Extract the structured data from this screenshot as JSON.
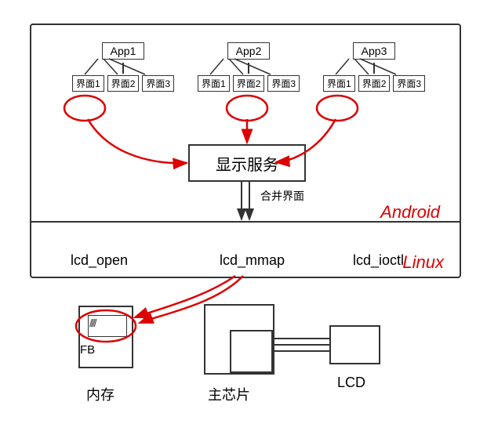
{
  "apps": [
    {
      "name": "App1",
      "ui": [
        "界面1",
        "界面2",
        "界面3"
      ]
    },
    {
      "name": "App2",
      "ui": [
        "界面1",
        "界面2",
        "界面3"
      ]
    },
    {
      "name": "App3",
      "ui": [
        "界面1",
        "界面2",
        "界面3"
      ]
    }
  ],
  "display_service": "显示服务",
  "merge_label": "合并界面",
  "syscalls": {
    "open": "lcd_open",
    "mmap": "lcd_mmap",
    "ioctl": "lcd_ioctl"
  },
  "os_labels": {
    "android": "Android",
    "linux": "Linux"
  },
  "hw": {
    "fb": "FB",
    "mem": "内存",
    "chip": "主芯片",
    "lcd": "LCD"
  },
  "chart_data": {
    "type": "diagram",
    "title": "Android display stack to Linux framebuffer/LCD",
    "nodes": [
      {
        "id": "app1",
        "label": "App1",
        "children": [
          "界面1",
          "界面2",
          "界面3"
        ]
      },
      {
        "id": "app2",
        "label": "App2",
        "children": [
          "界面1",
          "界面2",
          "界面3"
        ]
      },
      {
        "id": "app3",
        "label": "App3",
        "children": [
          "界面1",
          "界面2",
          "界面3"
        ]
      },
      {
        "id": "display_service",
        "label": "显示服务"
      },
      {
        "id": "merge",
        "label": "合并界面"
      },
      {
        "id": "lcd_open",
        "label": "lcd_open"
      },
      {
        "id": "lcd_mmap",
        "label": "lcd_mmap"
      },
      {
        "id": "lcd_ioctl",
        "label": "lcd_ioctl"
      },
      {
        "id": "fb",
        "label": "FB"
      },
      {
        "id": "mem",
        "label": "内存"
      },
      {
        "id": "chip",
        "label": "主芯片"
      },
      {
        "id": "lcd_hw",
        "label": "LCD"
      }
    ],
    "edges": [
      {
        "from": "app1/界面1",
        "to": "display_service",
        "highlight": true
      },
      {
        "from": "app2/界面2",
        "to": "display_service",
        "highlight": true
      },
      {
        "from": "app3/界面1",
        "to": "display_service",
        "highlight": true
      },
      {
        "from": "display_service",
        "to": "merge"
      },
      {
        "from": "merge",
        "to": "lcd_mmap"
      },
      {
        "from": "lcd_mmap",
        "to": "fb",
        "highlight": true
      },
      {
        "from": "chip",
        "to": "lcd_hw"
      }
    ],
    "layers": [
      {
        "name": "Android",
        "contains": [
          "app1",
          "app2",
          "app3",
          "display_service",
          "merge"
        ]
      },
      {
        "name": "Linux",
        "contains": [
          "lcd_open",
          "lcd_mmap",
          "lcd_ioctl"
        ]
      }
    ],
    "circled_nodes": [
      "app1/界面1",
      "app2/界面2",
      "app3/界面1",
      "fb"
    ]
  }
}
